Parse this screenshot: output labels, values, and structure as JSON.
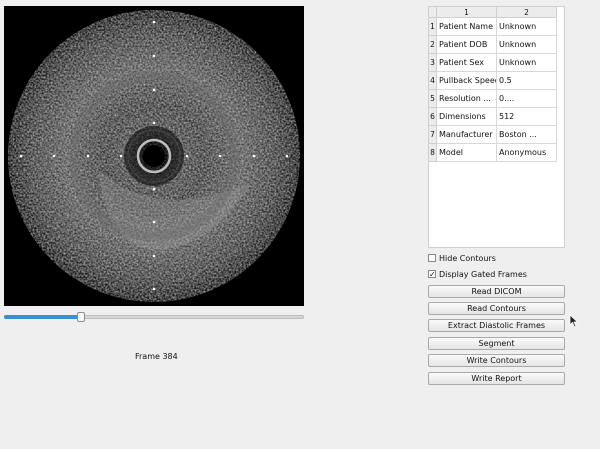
{
  "viewer": {
    "frame_label": "Frame 384"
  },
  "slider": {
    "progress": 0.25
  },
  "table": {
    "columns": [
      "1",
      "2"
    ],
    "rows": [
      {
        "index": "1",
        "key": "Patient Name",
        "value": "Unknown"
      },
      {
        "index": "2",
        "key": "Patient DOB",
        "value": "Unknown"
      },
      {
        "index": "3",
        "key": "Patient Sex",
        "value": "Unknown"
      },
      {
        "index": "4",
        "key": "Pullback Speed",
        "value": "0.5"
      },
      {
        "index": "5",
        "key": "Resolution ...",
        "value": "0...."
      },
      {
        "index": "6",
        "key": "Dimensions",
        "value": "512"
      },
      {
        "index": "7",
        "key": "Manufacturer",
        "value": "Boston ..."
      },
      {
        "index": "8",
        "key": "Model",
        "value": "Anonymous"
      }
    ]
  },
  "controls": {
    "hide_contours": {
      "label": "Hide Contours",
      "checked": false
    },
    "display_gated": {
      "label": "Display Gated Frames",
      "checked": true,
      "mark": "✓"
    },
    "buttons": {
      "read_dicom": "Read DICOM",
      "read_contours": "Read Contours",
      "extract_diastolic": "Extract Diastolic Frames",
      "segment": "Segment",
      "write_contours": "Write Contours",
      "write_report": "Write Report"
    }
  },
  "colors": {
    "accent": "#3d8ec9",
    "background": "#efefef"
  },
  "icons": {
    "cursor": "mouse-pointer-icon"
  }
}
